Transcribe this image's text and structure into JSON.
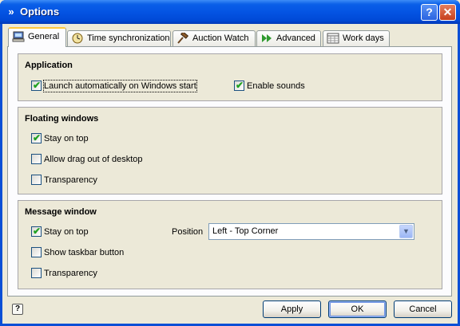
{
  "window": {
    "title": "Options",
    "title_icon": "chevron-down-double-icon"
  },
  "titlebar_buttons": {
    "help": "?",
    "close": "✕"
  },
  "tabs": [
    {
      "label": "General",
      "icon": "computer-icon",
      "active": true
    },
    {
      "label": "Time synchronization",
      "icon": "clock-icon",
      "active": false
    },
    {
      "label": "Auction Watch",
      "icon": "gavel-icon",
      "active": false
    },
    {
      "label": "Advanced",
      "icon": "double-arrow-icon",
      "active": false
    },
    {
      "label": "Work days",
      "icon": "calendar-grid-icon",
      "active": false
    }
  ],
  "application": {
    "title": "Application",
    "launch_label": "Launch automatically on Windows start",
    "launch_checked": true,
    "sounds_label": "Enable sounds",
    "sounds_checked": true
  },
  "floating": {
    "title": "Floating windows",
    "stay_on_top_label": "Stay on top",
    "stay_on_top_checked": true,
    "drag_label": "Allow drag out of desktop",
    "drag_checked": false,
    "transparency_label": "Transparency",
    "transparency_checked": false
  },
  "message": {
    "title": "Message window",
    "stay_on_top_label": "Stay on top",
    "stay_on_top_checked": true,
    "taskbar_label": "Show taskbar button",
    "taskbar_checked": false,
    "transparency_label": "Transparency",
    "transparency_checked": false,
    "position_label": "Position",
    "position_value": "Left - Top Corner"
  },
  "buttons": {
    "apply": "Apply",
    "ok": "OK",
    "cancel": "Cancel"
  },
  "colors": {
    "titlebar": "#0454e3",
    "tab_highlight": "#ffc83c",
    "checkmark": "#21a121",
    "face": "#ece9d8"
  }
}
